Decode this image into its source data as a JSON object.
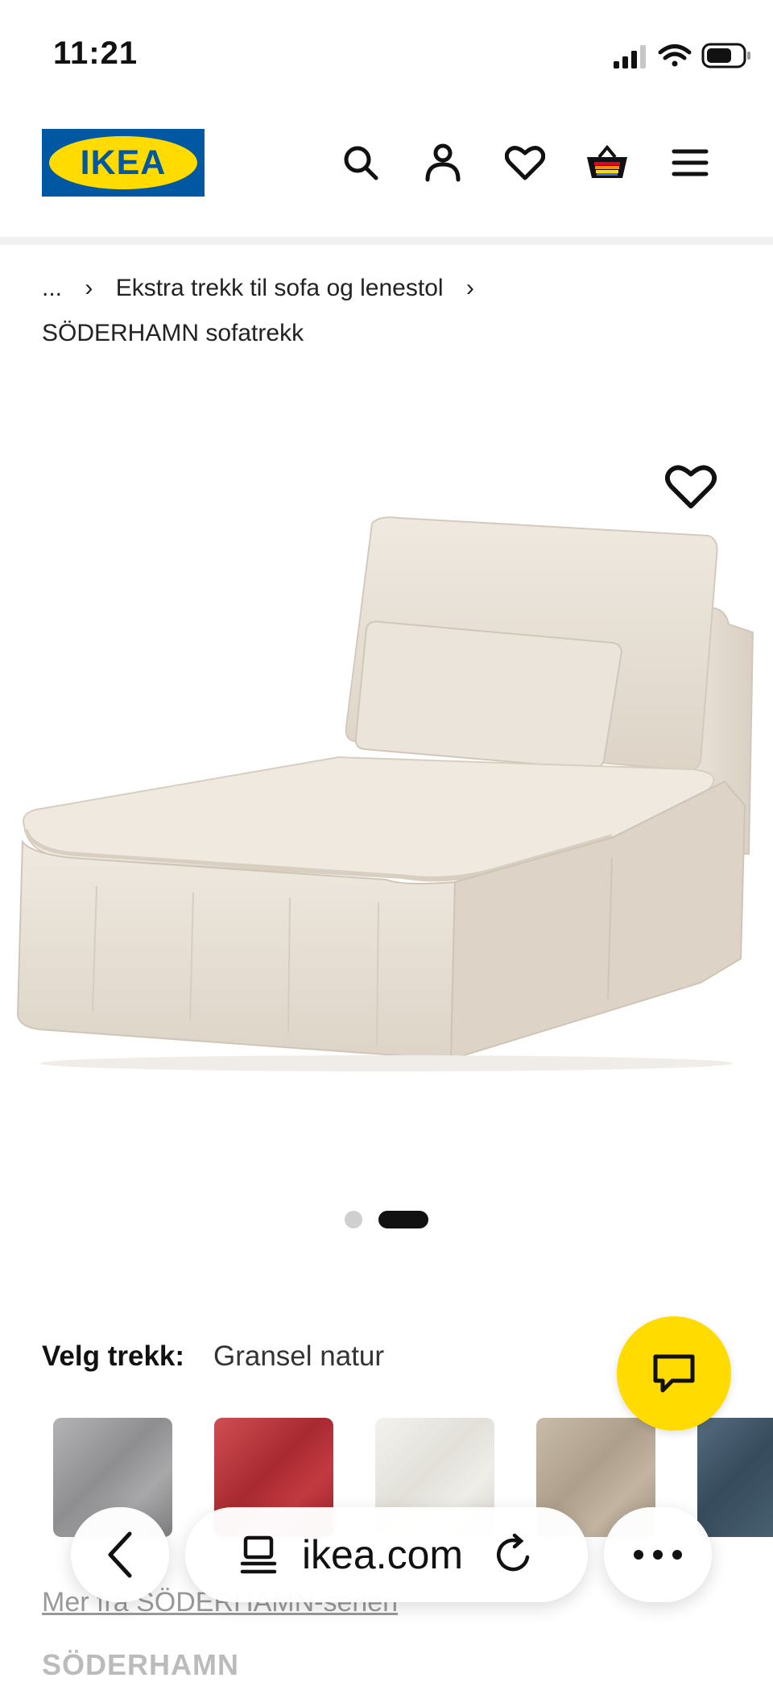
{
  "status_bar": {
    "time": "11:21"
  },
  "header": {
    "logo_text": "IKEA",
    "icons": [
      "search-icon",
      "account-icon",
      "heart-icon",
      "basket-icon",
      "menu-icon"
    ]
  },
  "breadcrumb": {
    "ellipsis": "...",
    "category": "Ekstra trekk til sofa og lenestol",
    "current": "SÖDERHAMN sofatrekk"
  },
  "carousel": {
    "total": 2,
    "active_index": 1
  },
  "cover_selection": {
    "label": "Velg trekk:",
    "value": "Gransel natur",
    "swatch_colors": [
      "#9b9b9d",
      "#b8343a",
      "#e8e6df",
      "#b9ab98",
      "#3e5567"
    ]
  },
  "series_link": "Mer fra SÖDERHAMN-serien",
  "series_title": "SÖDERHAMN",
  "browser": {
    "url": "ikea.com"
  },
  "colors": {
    "ikea_blue": "#0058a3",
    "ikea_yellow": "#ffdb00",
    "sofa_fabric": "#e7dfd3"
  }
}
